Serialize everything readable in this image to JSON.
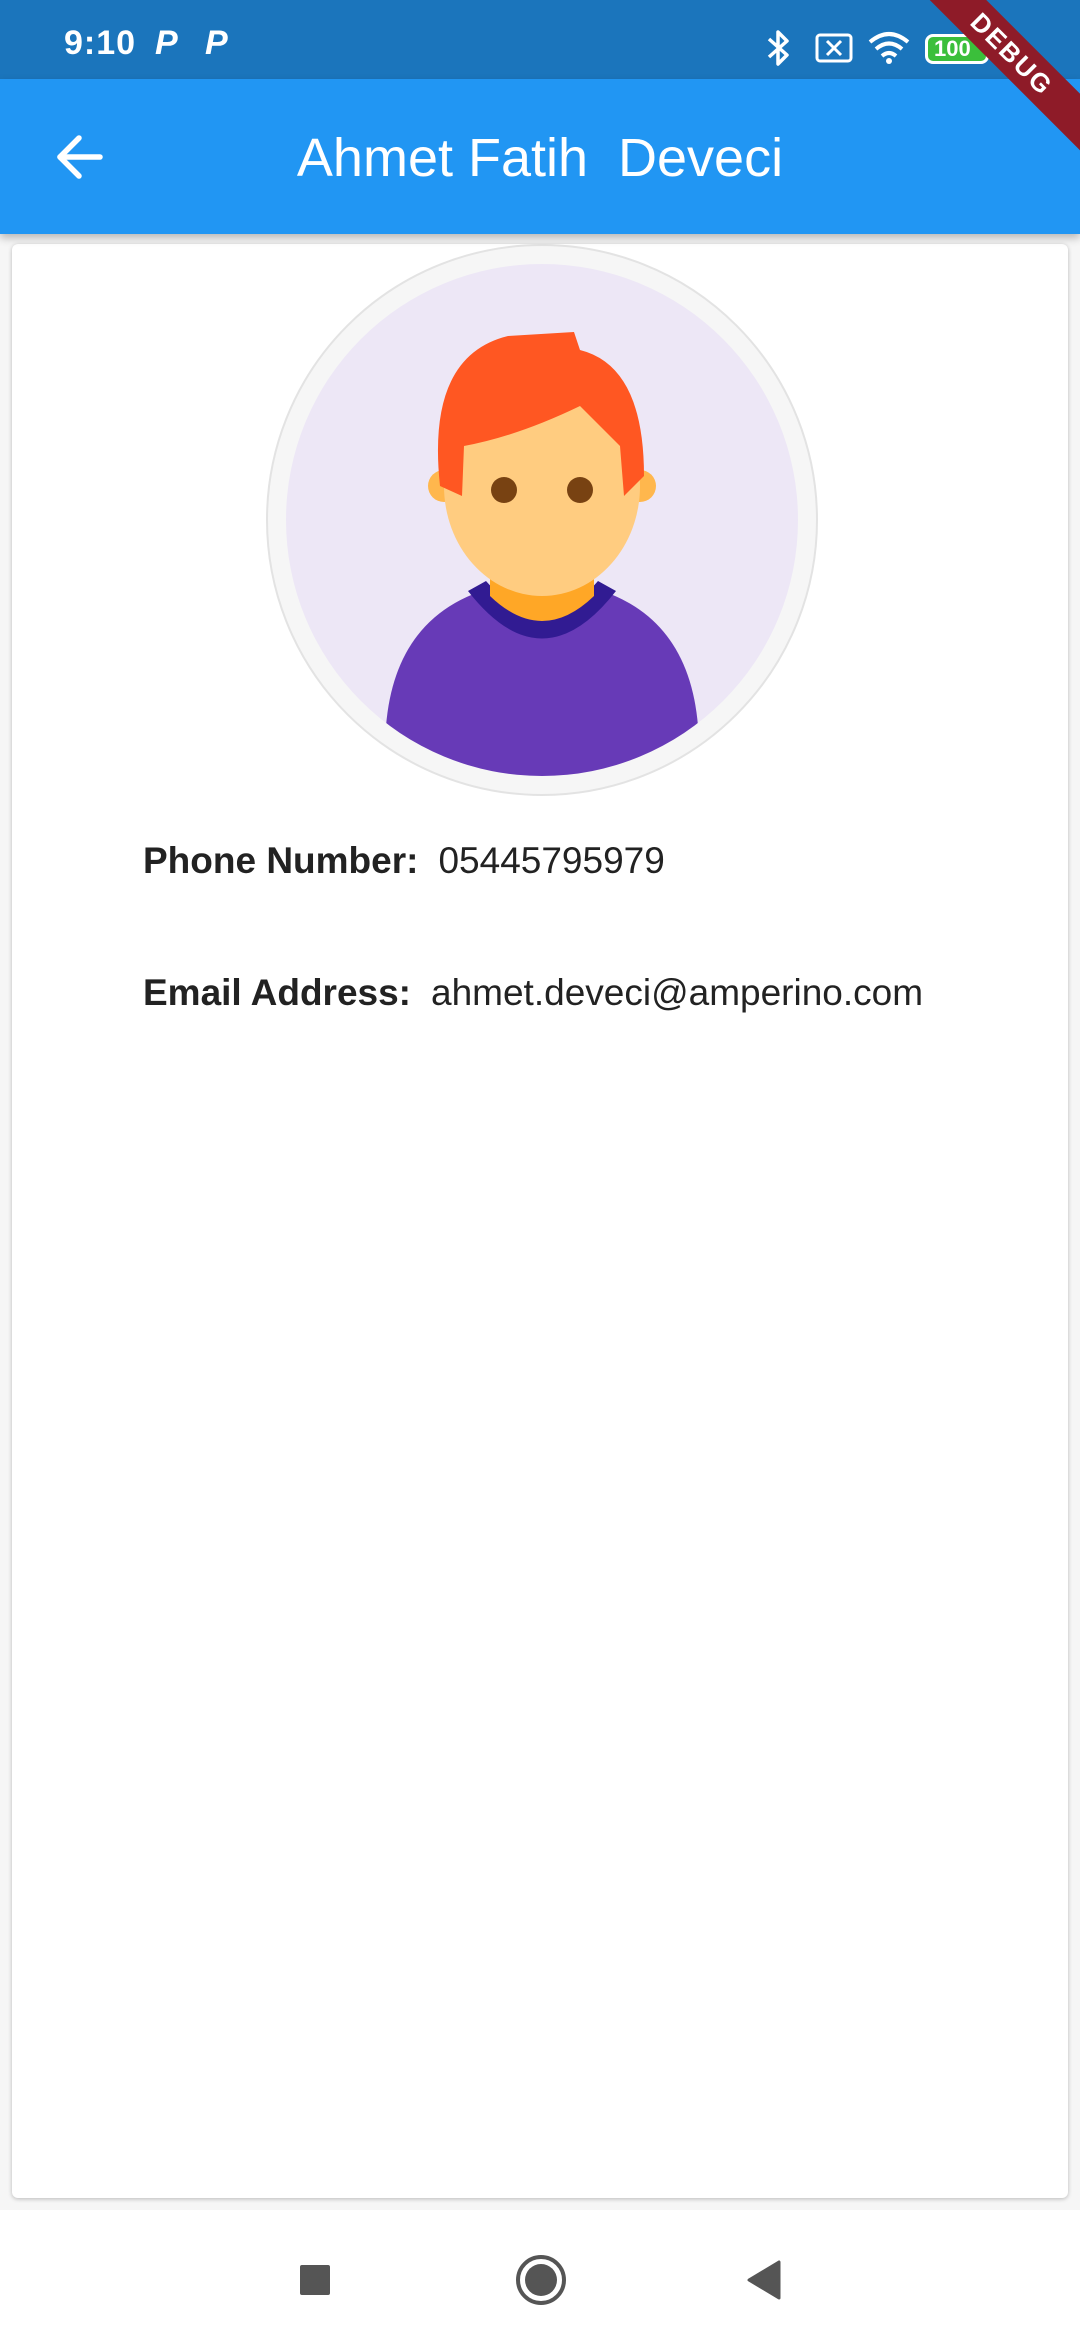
{
  "status_bar": {
    "time": "9:10",
    "p_icons": [
      "P",
      "P"
    ],
    "battery": "100",
    "icons": [
      "bluetooth-icon",
      "no-sim-icon",
      "wifi-icon",
      "battery-icon"
    ]
  },
  "debug_banner": {
    "label": "DEBUG"
  },
  "app_bar": {
    "title": "Ahmet Fatih  Deveci",
    "back_icon": "arrow-back-icon",
    "color": "#2196f3"
  },
  "profile": {
    "avatar_icon": "person-avatar-icon",
    "phone": {
      "label": "Phone Number:",
      "value": "05445795979"
    },
    "email": {
      "label": "Email Address:",
      "value": "ahmet.deveci@amperino.com"
    }
  },
  "nav_bar": {
    "buttons": [
      "recents-square-icon",
      "home-circle-icon",
      "back-triangle-icon"
    ]
  }
}
